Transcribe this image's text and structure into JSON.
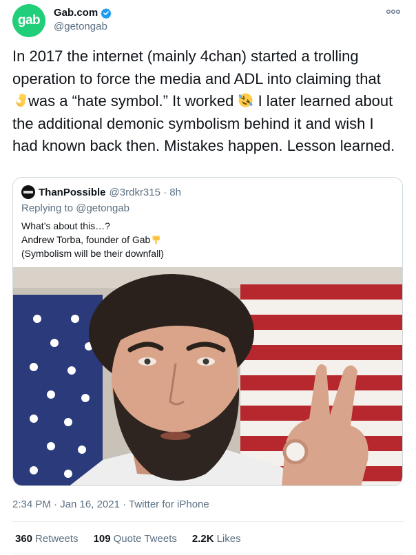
{
  "author": {
    "avatar_text": "gab",
    "display_name": "Gab.com",
    "handle": "@getongab",
    "verified": true,
    "avatar_color": "#21cf7a"
  },
  "tweet": {
    "text_1": "In 2017 the internet (mainly 4chan) started a trolling operation to force the media and ADL into claiming that ",
    "emoji_1": "ok-hand-emoji",
    "text_2": "was a “hate symbol.” It worked ",
    "emoji_2": "rolling-laughing-emoji",
    "text_3": " I later learned about the additional demonic symbolism behind it and wish I had known back then. Mistakes happen. Lesson learned."
  },
  "quoted": {
    "name": "ThanPossible",
    "handle_time": "@3rdkr315 · 8h",
    "replying_prefix": "Replying to ",
    "replying_to": "@getongab",
    "line_1": "What’s about this…?",
    "line_2": "Andrew Torba, founder of Gab",
    "line_2_emoji": "pointing-down-emoji",
    "line_3": "(Symbolism will be their downfall)"
  },
  "meta": {
    "timestamp": "2:34 PM · Jan 16, 2021 · ",
    "source": "Twitter for iPhone"
  },
  "stats": {
    "retweets_count": "360",
    "retweets_label": "Retweets",
    "quotes_count": "109",
    "quotes_label": "Quote Tweets",
    "likes_count": "2.2K",
    "likes_label": "Likes"
  }
}
